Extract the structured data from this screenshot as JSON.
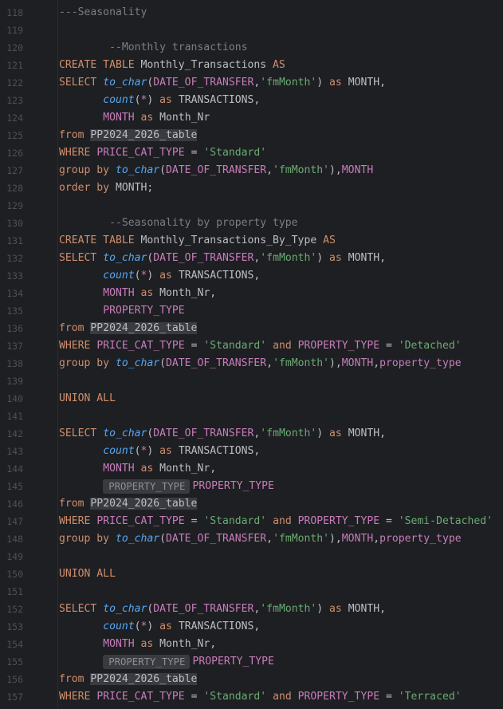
{
  "editor": {
    "lines": [
      {
        "no": "118",
        "tokens": [
          {
            "t": "---Seasonality",
            "c": "cm"
          }
        ]
      },
      {
        "no": "119",
        "tokens": []
      },
      {
        "no": "120",
        "tokens": [
          {
            "t": "        --Monthly transactions",
            "c": "cm"
          }
        ]
      },
      {
        "no": "121",
        "tokens": [
          {
            "t": "CREATE TABLE ",
            "c": "kw"
          },
          {
            "t": "Monthly_Transactions ",
            "c": "id"
          },
          {
            "t": "AS",
            "c": "kw"
          }
        ]
      },
      {
        "no": "122",
        "tokens": [
          {
            "t": "SELECT ",
            "c": "kw"
          },
          {
            "t": "to_char",
            "c": "fn"
          },
          {
            "t": "(",
            "c": "id"
          },
          {
            "t": "DATE_OF_TRANSFER",
            "c": "co"
          },
          {
            "t": ",",
            "c": "id"
          },
          {
            "t": "'fmMonth'",
            "c": "st"
          },
          {
            "t": ") ",
            "c": "id"
          },
          {
            "t": "as ",
            "c": "kw"
          },
          {
            "t": "MONTH,",
            "c": "id"
          }
        ]
      },
      {
        "no": "123",
        "tokens": [
          {
            "t": "       ",
            "c": "id"
          },
          {
            "t": "count",
            "c": "fn"
          },
          {
            "t": "(",
            "c": "id"
          },
          {
            "t": "*",
            "c": "ast"
          },
          {
            "t": ") ",
            "c": "id"
          },
          {
            "t": "as ",
            "c": "kw"
          },
          {
            "t": "TRANSACTIONS,",
            "c": "id"
          }
        ]
      },
      {
        "no": "124",
        "tokens": [
          {
            "t": "       ",
            "c": "id"
          },
          {
            "t": "MONTH ",
            "c": "co"
          },
          {
            "t": "as ",
            "c": "kw"
          },
          {
            "t": "Month_Nr",
            "c": "id"
          }
        ]
      },
      {
        "no": "125",
        "tokens": [
          {
            "t": "from ",
            "c": "kw"
          },
          {
            "t": "PP2024_2026_table",
            "c": "tbl"
          }
        ]
      },
      {
        "no": "126",
        "tokens": [
          {
            "t": "WHERE ",
            "c": "kw"
          },
          {
            "t": "PRICE_CAT_TYPE ",
            "c": "co"
          },
          {
            "t": "= ",
            "c": "id"
          },
          {
            "t": "'Standard'",
            "c": "st"
          }
        ]
      },
      {
        "no": "127",
        "tokens": [
          {
            "t": "group by ",
            "c": "kw"
          },
          {
            "t": "to_char",
            "c": "fn"
          },
          {
            "t": "(",
            "c": "id"
          },
          {
            "t": "DATE_OF_TRANSFER",
            "c": "co"
          },
          {
            "t": ",",
            "c": "id"
          },
          {
            "t": "'fmMonth'",
            "c": "st"
          },
          {
            "t": "),",
            "c": "id"
          },
          {
            "t": "MONTH",
            "c": "co"
          }
        ]
      },
      {
        "no": "128",
        "tokens": [
          {
            "t": "order by ",
            "c": "kw"
          },
          {
            "t": "MONTH;",
            "c": "id"
          }
        ]
      },
      {
        "no": "129",
        "tokens": []
      },
      {
        "no": "130",
        "tokens": [
          {
            "t": "        --Seasonality by property type",
            "c": "cm"
          }
        ]
      },
      {
        "no": "131",
        "tokens": [
          {
            "t": "CREATE TABLE ",
            "c": "kw"
          },
          {
            "t": "Monthly_Transactions_By_Type ",
            "c": "id"
          },
          {
            "t": "AS",
            "c": "kw"
          }
        ]
      },
      {
        "no": "132",
        "tokens": [
          {
            "t": "SELECT ",
            "c": "kw"
          },
          {
            "t": "to_char",
            "c": "fn"
          },
          {
            "t": "(",
            "c": "id"
          },
          {
            "t": "DATE_OF_TRANSFER",
            "c": "co"
          },
          {
            "t": ",",
            "c": "id"
          },
          {
            "t": "'fmMonth'",
            "c": "st"
          },
          {
            "t": ") ",
            "c": "id"
          },
          {
            "t": "as ",
            "c": "kw"
          },
          {
            "t": "MONTH,",
            "c": "id"
          }
        ]
      },
      {
        "no": "133",
        "tokens": [
          {
            "t": "       ",
            "c": "id"
          },
          {
            "t": "count",
            "c": "fn"
          },
          {
            "t": "(",
            "c": "id"
          },
          {
            "t": "*",
            "c": "ast"
          },
          {
            "t": ") ",
            "c": "id"
          },
          {
            "t": "as ",
            "c": "kw"
          },
          {
            "t": "TRANSACTIONS,",
            "c": "id"
          }
        ]
      },
      {
        "no": "134",
        "tokens": [
          {
            "t": "       ",
            "c": "id"
          },
          {
            "t": "MONTH ",
            "c": "co"
          },
          {
            "t": "as ",
            "c": "kw"
          },
          {
            "t": "Month_Nr,",
            "c": "id"
          }
        ]
      },
      {
        "no": "135",
        "tokens": [
          {
            "t": "       ",
            "c": "id"
          },
          {
            "t": "PROPERTY_TYPE",
            "c": "co"
          }
        ]
      },
      {
        "no": "136",
        "tokens": [
          {
            "t": "from ",
            "c": "kw"
          },
          {
            "t": "PP2024_2026_table",
            "c": "tbl"
          }
        ]
      },
      {
        "no": "137",
        "tokens": [
          {
            "t": "WHERE ",
            "c": "kw"
          },
          {
            "t": "PRICE_CAT_TYPE ",
            "c": "co"
          },
          {
            "t": "= ",
            "c": "id"
          },
          {
            "t": "'Standard' ",
            "c": "st"
          },
          {
            "t": "and ",
            "c": "kw"
          },
          {
            "t": "PROPERTY_TYPE ",
            "c": "co"
          },
          {
            "t": "= ",
            "c": "id"
          },
          {
            "t": "'Detached'",
            "c": "st"
          }
        ]
      },
      {
        "no": "138",
        "tokens": [
          {
            "t": "group by ",
            "c": "kw"
          },
          {
            "t": "to_char",
            "c": "fn"
          },
          {
            "t": "(",
            "c": "id"
          },
          {
            "t": "DATE_OF_TRANSFER",
            "c": "co"
          },
          {
            "t": ",",
            "c": "id"
          },
          {
            "t": "'fmMonth'",
            "c": "st"
          },
          {
            "t": "),",
            "c": "id"
          },
          {
            "t": "MONTH",
            "c": "co"
          },
          {
            "t": ",",
            "c": "id"
          },
          {
            "t": "property_type",
            "c": "co"
          }
        ]
      },
      {
        "no": "139",
        "tokens": []
      },
      {
        "no": "140",
        "tokens": [
          {
            "t": "UNION ALL",
            "c": "kw"
          }
        ]
      },
      {
        "no": "141",
        "tokens": []
      },
      {
        "no": "142",
        "tokens": [
          {
            "t": "SELECT ",
            "c": "kw"
          },
          {
            "t": "to_char",
            "c": "fn"
          },
          {
            "t": "(",
            "c": "id"
          },
          {
            "t": "DATE_OF_TRANSFER",
            "c": "co"
          },
          {
            "t": ",",
            "c": "id"
          },
          {
            "t": "'fmMonth'",
            "c": "st"
          },
          {
            "t": ") ",
            "c": "id"
          },
          {
            "t": "as ",
            "c": "kw"
          },
          {
            "t": "MONTH,",
            "c": "id"
          }
        ]
      },
      {
        "no": "143",
        "tokens": [
          {
            "t": "       ",
            "c": "id"
          },
          {
            "t": "count",
            "c": "fn"
          },
          {
            "t": "(",
            "c": "id"
          },
          {
            "t": "*",
            "c": "ast"
          },
          {
            "t": ") ",
            "c": "id"
          },
          {
            "t": "as ",
            "c": "kw"
          },
          {
            "t": "TRANSACTIONS,",
            "c": "id"
          }
        ]
      },
      {
        "no": "144",
        "tokens": [
          {
            "t": "       ",
            "c": "id"
          },
          {
            "t": "MONTH ",
            "c": "co"
          },
          {
            "t": "as ",
            "c": "kw"
          },
          {
            "t": "Month_Nr,",
            "c": "id"
          }
        ]
      },
      {
        "no": "145",
        "tokens": [
          {
            "t": "       ",
            "c": "id"
          },
          {
            "t": "PROPERTY_TYPE",
            "c": "hint"
          },
          {
            "t": "PROPERTY_TYPE",
            "c": "co"
          }
        ]
      },
      {
        "no": "146",
        "tokens": [
          {
            "t": "from ",
            "c": "kw"
          },
          {
            "t": "PP2024_2026_table",
            "c": "tbl"
          }
        ]
      },
      {
        "no": "147",
        "tokens": [
          {
            "t": "WHERE ",
            "c": "kw"
          },
          {
            "t": "PRICE_CAT_TYPE ",
            "c": "co"
          },
          {
            "t": "= ",
            "c": "id"
          },
          {
            "t": "'Standard' ",
            "c": "st"
          },
          {
            "t": "and ",
            "c": "kw"
          },
          {
            "t": "PROPERTY_TYPE ",
            "c": "co"
          },
          {
            "t": "= ",
            "c": "id"
          },
          {
            "t": "'Semi-Detached'",
            "c": "st"
          }
        ]
      },
      {
        "no": "148",
        "tokens": [
          {
            "t": "group by ",
            "c": "kw"
          },
          {
            "t": "to_char",
            "c": "fn"
          },
          {
            "t": "(",
            "c": "id"
          },
          {
            "t": "DATE_OF_TRANSFER",
            "c": "co"
          },
          {
            "t": ",",
            "c": "id"
          },
          {
            "t": "'fmMonth'",
            "c": "st"
          },
          {
            "t": "),",
            "c": "id"
          },
          {
            "t": "MONTH",
            "c": "co"
          },
          {
            "t": ",",
            "c": "id"
          },
          {
            "t": "property_type",
            "c": "co"
          }
        ]
      },
      {
        "no": "149",
        "tokens": []
      },
      {
        "no": "150",
        "tokens": [
          {
            "t": "UNION ALL",
            "c": "kw"
          }
        ]
      },
      {
        "no": "151",
        "tokens": []
      },
      {
        "no": "152",
        "tokens": [
          {
            "t": "SELECT ",
            "c": "kw"
          },
          {
            "t": "to_char",
            "c": "fn"
          },
          {
            "t": "(",
            "c": "id"
          },
          {
            "t": "DATE_OF_TRANSFER",
            "c": "co"
          },
          {
            "t": ",",
            "c": "id"
          },
          {
            "t": "'fmMonth'",
            "c": "st"
          },
          {
            "t": ") ",
            "c": "id"
          },
          {
            "t": "as ",
            "c": "kw"
          },
          {
            "t": "MONTH,",
            "c": "id"
          }
        ]
      },
      {
        "no": "153",
        "tokens": [
          {
            "t": "       ",
            "c": "id"
          },
          {
            "t": "count",
            "c": "fn"
          },
          {
            "t": "(",
            "c": "id"
          },
          {
            "t": "*",
            "c": "ast"
          },
          {
            "t": ") ",
            "c": "id"
          },
          {
            "t": "as ",
            "c": "kw"
          },
          {
            "t": "TRANSACTIONS,",
            "c": "id"
          }
        ]
      },
      {
        "no": "154",
        "tokens": [
          {
            "t": "       ",
            "c": "id"
          },
          {
            "t": "MONTH ",
            "c": "co"
          },
          {
            "t": "as ",
            "c": "kw"
          },
          {
            "t": "Month_Nr,",
            "c": "id"
          }
        ]
      },
      {
        "no": "155",
        "tokens": [
          {
            "t": "       ",
            "c": "id"
          },
          {
            "t": "PROPERTY_TYPE",
            "c": "hint"
          },
          {
            "t": "PROPERTY_TYPE",
            "c": "co"
          }
        ]
      },
      {
        "no": "156",
        "tokens": [
          {
            "t": "from ",
            "c": "kw"
          },
          {
            "t": "PP2024_2026_table",
            "c": "tbl"
          }
        ]
      },
      {
        "no": "157",
        "tokens": [
          {
            "t": "WHERE ",
            "c": "kw"
          },
          {
            "t": "PRICE_CAT_TYPE ",
            "c": "co"
          },
          {
            "t": "= ",
            "c": "id"
          },
          {
            "t": "'Standard' ",
            "c": "st"
          },
          {
            "t": "and ",
            "c": "kw"
          },
          {
            "t": "PROPERTY_TYPE ",
            "c": "co"
          },
          {
            "t": "= ",
            "c": "id"
          },
          {
            "t": "'Terraced'",
            "c": "st"
          }
        ]
      }
    ]
  },
  "colors": {
    "background": "#1e1f22",
    "keyword": "#cf8e6d",
    "function": "#56a8f5",
    "string": "#6aab73",
    "comment": "#7a7e85",
    "column": "#c77dbb",
    "identifier": "#bcbec4",
    "line_number": "#4b5059"
  }
}
